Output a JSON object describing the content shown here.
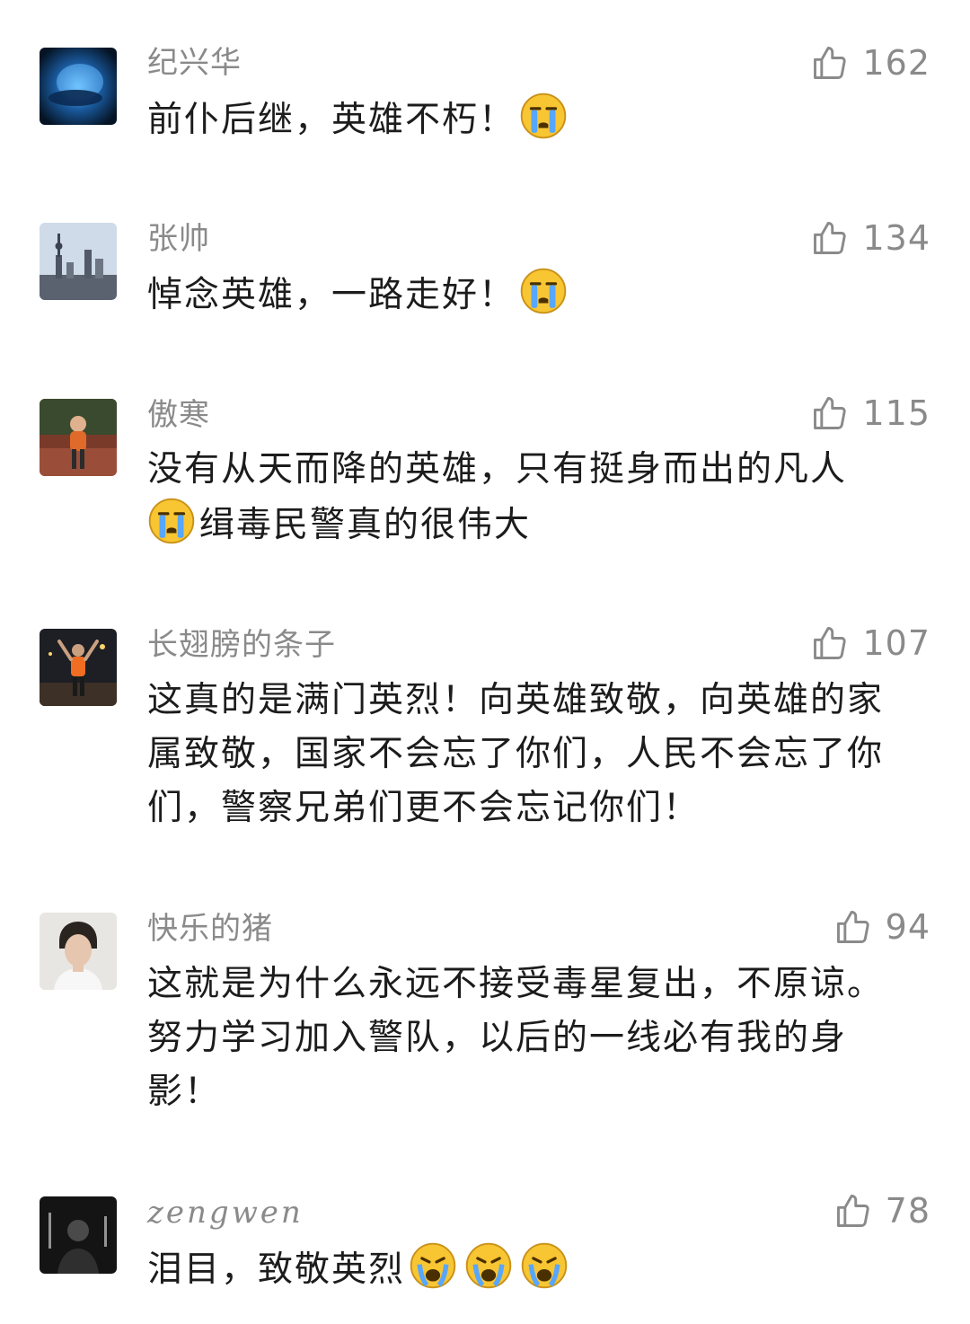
{
  "comments": [
    {
      "username": "纪兴华",
      "likes": "162",
      "text_parts": [
        "前仆后继，英雄不朽！"
      ],
      "emoji_names": [
        "crying-emoji"
      ]
    },
    {
      "username": "张帅",
      "likes": "134",
      "text_parts": [
        "悼念英雄，一路走好！"
      ],
      "emoji_names": [
        "crying-emoji"
      ]
    },
    {
      "username": "傲寒",
      "likes": "115",
      "text_parts": [
        "没有从天而降的英雄，只有挺身而出的凡人",
        "缉毒民警真的很伟大"
      ],
      "emoji_names": [
        "crying-emoji"
      ]
    },
    {
      "username": "长翅膀的条子",
      "likes": "107",
      "text_parts": [
        "这真的是满门英烈！向英雄致敬，向英雄的家属致敬，国家不会忘了你们，人民不会忘了你们，警察兄弟们更不会忘记你们！"
      ],
      "emoji_names": []
    },
    {
      "username": "快乐的猪",
      "likes": "94",
      "text_parts": [
        "这就是为什么永远不接受毒星复出，不原谅。努力学习加入警队，以后的一线必有我的身影！"
      ],
      "emoji_names": []
    },
    {
      "username": "zengwen",
      "likes": "78",
      "text_parts": [
        "泪目，致敬英烈"
      ],
      "emoji_names": [
        "loudly-crying-emoji",
        "loudly-crying-emoji",
        "loudly-crying-emoji"
      ]
    }
  ],
  "icons": {
    "like": "thumbs-up-icon"
  },
  "colors": {
    "username": "#8a8a8a",
    "text": "#1c1c1c",
    "like": "#8a8a8a",
    "emoji": "#f8c533"
  }
}
